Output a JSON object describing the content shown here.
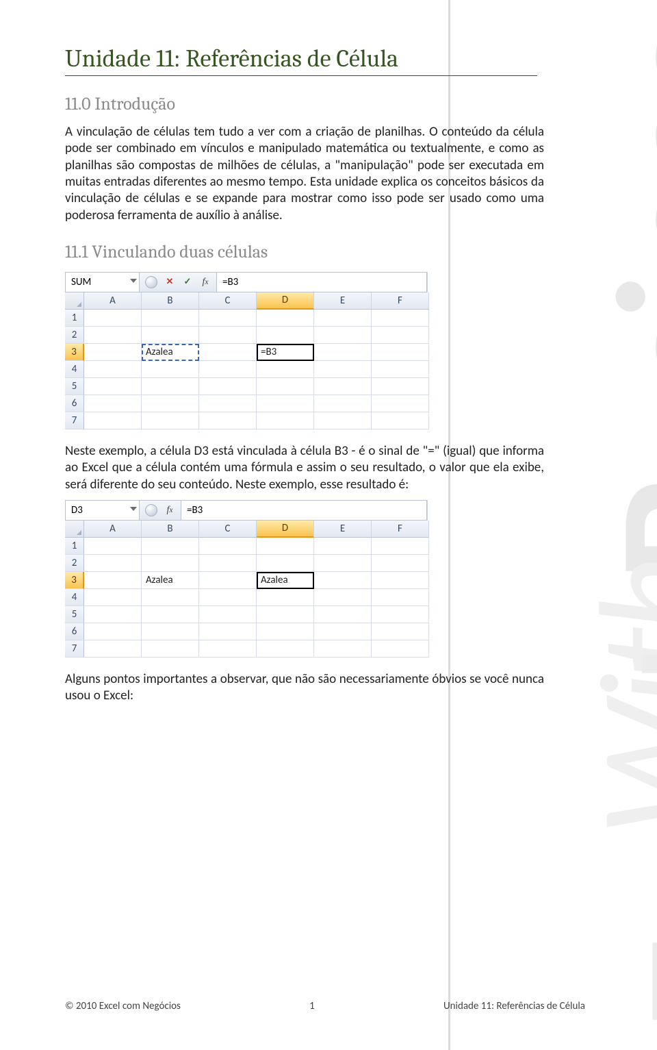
{
  "title": "Unidade 11: Referências de Célula",
  "section_intro": {
    "heading": "11.0 Introdução",
    "p1": "A vinculação de células tem tudo a ver com a criação de planilhas. O conteúdo da célula pode ser combinado em vínculos e manipulado matemática ou textualmente, e como as planilhas são compostas de milhões de células, a \"manipulação\" pode ser executada em muitas entradas diferentes ao mesmo tempo. Esta unidade explica os conceitos básicos da vinculação de células e se expande para mostrar como isso pode ser usado como uma poderosa ferramenta de auxílio à análise."
  },
  "section_link": {
    "heading": "11.1 Vinculando duas células",
    "p_after_shot1": "Neste exemplo, a célula D3 está vinculada à célula B3 - é o sinal de \"=\" (igual) que informa ao Excel que a célula contém uma fórmula e assim o seu resultado, o valor que ela exibe, será diferente do seu conteúdo. Neste exemplo, esse resultado é:",
    "p_after_shot2": "Alguns pontos importantes a observar, que não são necessariamente óbvios se você nunca usou o Excel:"
  },
  "shot1": {
    "namebox": "SUM",
    "formula": "=B3",
    "cols": [
      "A",
      "B",
      "C",
      "D",
      "E",
      "F"
    ],
    "rows": [
      "1",
      "2",
      "3",
      "4",
      "5",
      "6",
      "7"
    ],
    "b3": "Azalea",
    "d3": "=B3",
    "active_col": "D",
    "active_row": "3"
  },
  "shot2": {
    "namebox": "D3",
    "formula": "=B3",
    "cols": [
      "A",
      "B",
      "C",
      "D",
      "E",
      "F"
    ],
    "rows": [
      "1",
      "2",
      "3",
      "4",
      "5",
      "6",
      "7"
    ],
    "b3": "Azalea",
    "d3": "Azalea",
    "active_col": "D",
    "active_row": "3"
  },
  "footer": {
    "left": "© 2010 Excel com Negócios",
    "center": "1",
    "right": "Unidade 11: Referências de Célula"
  }
}
